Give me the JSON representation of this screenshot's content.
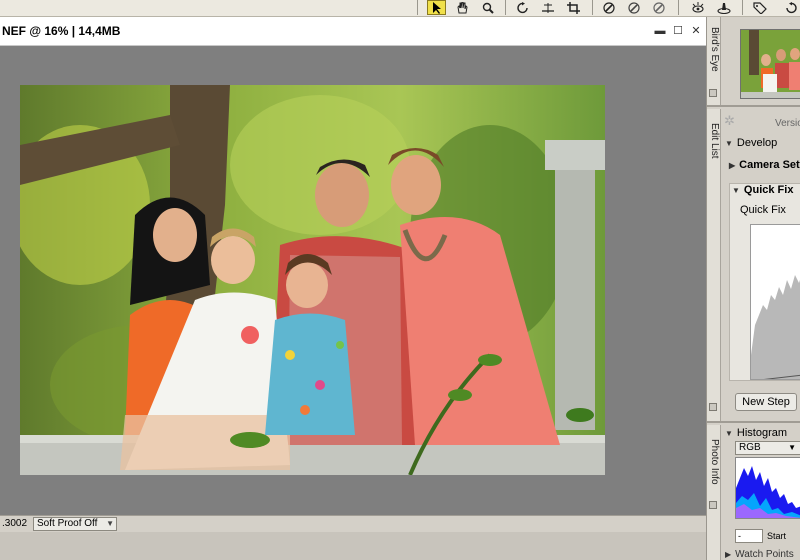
{
  "document": {
    "title": "NEF @ 16% | 14,4MB",
    "window_buttons": {
      "minimize": "▬",
      "restore": "☐",
      "close": "✕"
    }
  },
  "status": {
    "zoom_readout": ".3002",
    "soft_proof": "Soft Proof Off"
  },
  "panels": {
    "birds_eye": {
      "tab_label": "Bird's Eye"
    },
    "edit_list": {
      "tab_label": "Edit List",
      "versions_label": "Versio",
      "develop_label": "Develop",
      "camera_settings_label": "Camera Settin",
      "quick_fix_header": "Quick Fix",
      "quick_fix_item": "Quick Fix",
      "new_step_label": "New Step"
    },
    "photo_info": {
      "tab_label": "Photo Info",
      "histogram_label": "Histogram",
      "channel": "RGB",
      "start_value": "-",
      "start_label": "Start",
      "watch_points_label": "Watch Points"
    }
  },
  "toolbar": {
    "icons": [
      "arrow-select-icon",
      "hand-pan-icon",
      "zoom-icon",
      "rotate-icon",
      "straighten-icon",
      "crop-icon",
      "eyedropper-black-icon",
      "eyedropper-gray-icon",
      "eyedropper-white-icon",
      "red-eye-icon",
      "retouch-brush-icon",
      "tag-icon",
      "rotate-right-icon"
    ],
    "active_tool": "arrow-select-icon"
  },
  "colors": {
    "accent_active_tool": "#f0e04a",
    "canvas_bg": "#7f7f7f",
    "panel_bg": "#d4d0c8"
  }
}
